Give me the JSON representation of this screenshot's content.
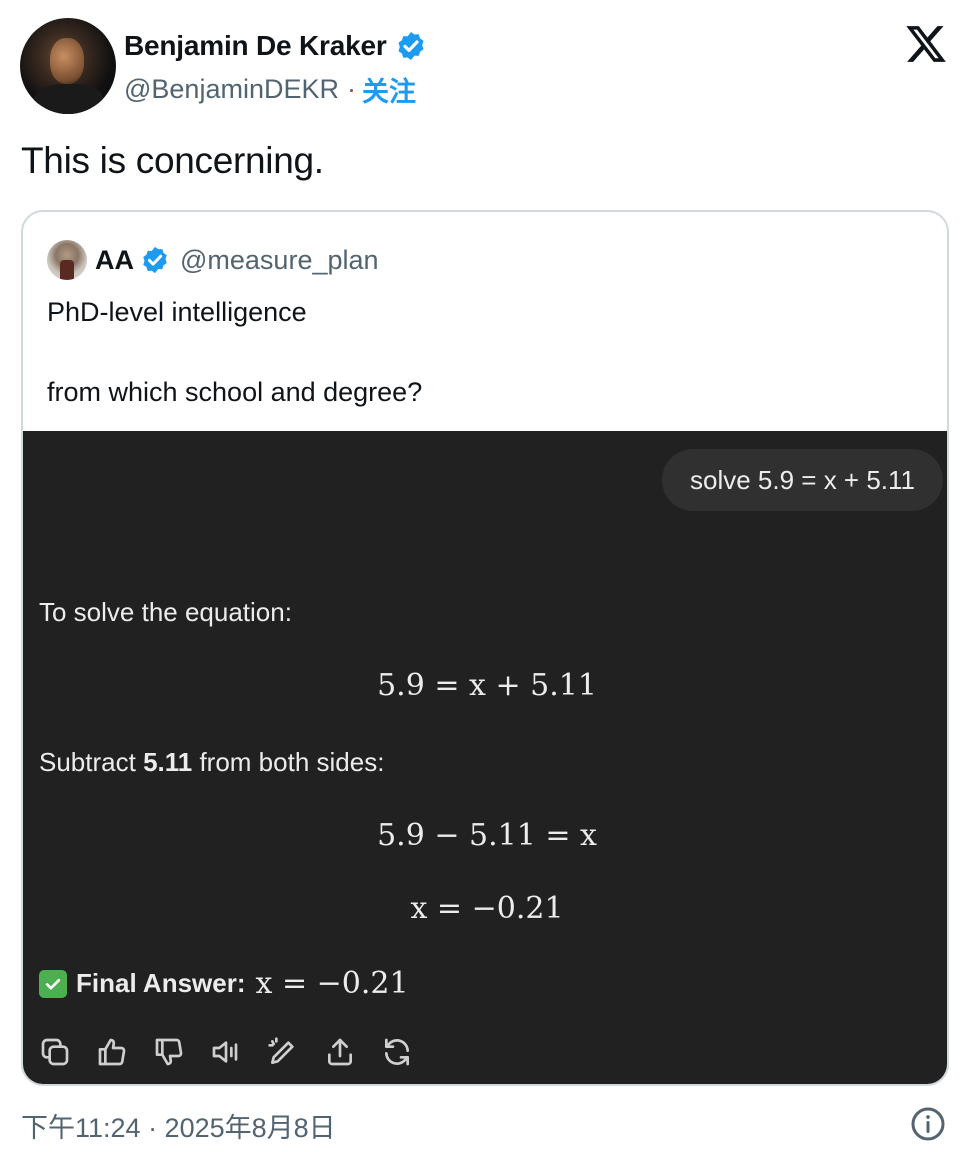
{
  "author": {
    "name": "Benjamin De Kraker",
    "handle": "@BenjaminDEKR",
    "separator": "·",
    "follow_label": "关注"
  },
  "tweet": {
    "text": "This is concerning."
  },
  "quoted": {
    "name": "AA",
    "handle": "@measure_plan",
    "line1": "PhD-level intelligence",
    "line2": "from which school and degree?"
  },
  "chat": {
    "user_prompt": "solve 5.9 = x + 5.11",
    "intro": "To solve the equation:",
    "equation1": "5.9 = x + 5.11",
    "step_prefix": "Subtract ",
    "step_bold": "5.11",
    "step_suffix": " from both sides:",
    "equation2": "5.9 − 5.11 = x",
    "equation3": "x = −0.21",
    "final_label": "Final Answer:",
    "final_math": "x = −0.21",
    "action_icons": [
      "copy-icon",
      "thumbs-up-icon",
      "thumbs-down-icon",
      "read-aloud-icon",
      "edit-icon",
      "share-icon",
      "regenerate-icon"
    ]
  },
  "footer": {
    "timestamp": "下午11:24 · 2025年8月8日"
  },
  "colors": {
    "verified": "#1d9bf0",
    "chat_bg": "#212121",
    "bubble_bg": "#303030",
    "muted": "#536471"
  }
}
